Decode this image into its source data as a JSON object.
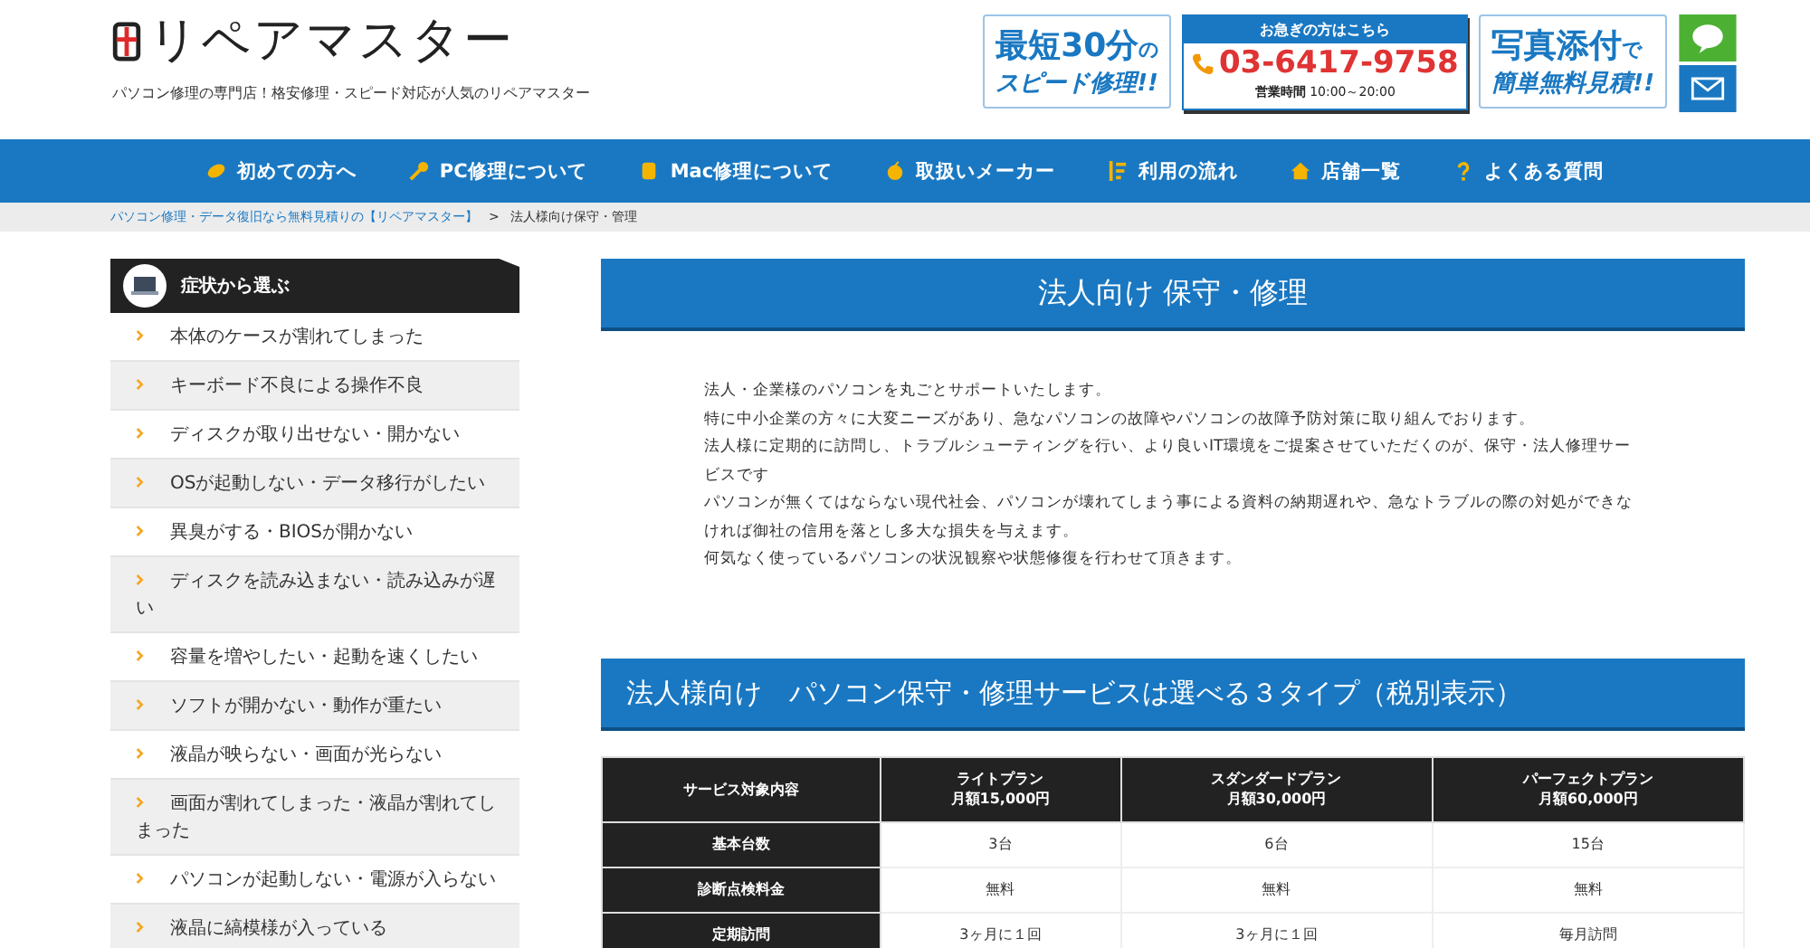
{
  "header": {
    "logo": "リペアマスター",
    "tagline": "パソコン修理の専門店！格安修理・スピード対応が人気のリペアマスター",
    "speed_banner": {
      "main": "最短30分",
      "suffix": "の",
      "sub": "スピード修理!!"
    },
    "phone_banner": {
      "label": "お急ぎの方はこちら",
      "number": "03-6417-9758",
      "hours_label": "営業時間",
      "hours": "10:00～20:00"
    },
    "photo_banner": {
      "main": "写真添付",
      "suffix": "で",
      "sub": "簡単無料見積!!"
    }
  },
  "nav": [
    {
      "label": "初めての方へ"
    },
    {
      "label": "PC修理について"
    },
    {
      "label": "Mac修理について"
    },
    {
      "label": "取扱いメーカー"
    },
    {
      "label": "利用の流れ"
    },
    {
      "label": "店舗一覧"
    },
    {
      "label": "よくある質問"
    }
  ],
  "breadcrumb": {
    "items": [
      "パソコン修理・データ復旧なら無料見積りの【リペアマスター】",
      "法人様向け保守・管理"
    ],
    "separator": ">"
  },
  "sidebar": {
    "title": "症状から選ぶ",
    "items": [
      "本体のケースが割れてしまった",
      "キーボード不良による操作不良",
      "ディスクが取り出せない・開かない",
      "OSが起動しない・データ移行がしたい",
      "異臭がする・BIOSが開かない",
      "ディスクを読み込まない・読み込みが遅い",
      "容量を増やしたい・起動を速くしたい",
      "ソフトが開かない・動作が重たい",
      "液晶が映らない・画面が光らない",
      "画面が割れてしまった・液晶が割れてしまった",
      "パソコンが起動しない・電源が入らない",
      "液晶に縞模様が入っている"
    ]
  },
  "main": {
    "heading": "法人向け 保守・修理",
    "paragraphs": [
      "法人・企業様のパソコンを丸ごとサポートいたします。",
      "特に中小企業の方々に大変ニーズがあり、急なパソコンの故障やパソコンの故障予防対策に取り組んでおります。",
      "法人様に定期的に訪問し、トラブルシューティングを行い、より良いIT環境をご提案させていただくのが、保守・法人修理サービスです",
      "パソコンが無くてはならない現代社会、パソコンが壊れてしまう事による資料の納期遅れや、急なトラブルの際の対処ができなければ御社の信用を落とし多大な損失を与えます。",
      "何気なく使っているパソコンの状況観察や状態修復を行わせて頂きます。"
    ],
    "heading2": "法人様向け　パソコン保守・修理サービスは選べる３タイプ（税別表示）",
    "table": {
      "columns": [
        {
          "name": "サービス対象内容"
        },
        {
          "name": "ライトプラン",
          "price": "月額15,000円"
        },
        {
          "name": "スダンダードプラン",
          "price": "月額30,000円"
        },
        {
          "name": "パーフェクトプラン",
          "price": "月額60,000円"
        }
      ],
      "rows": [
        {
          "cells": [
            "基本台数",
            "3台",
            "6台",
            "15台"
          ]
        },
        {
          "cells": [
            "診断点検料金",
            "無料",
            "無料",
            "無料"
          ]
        },
        {
          "cells": [
            "定期訪問",
            "3ヶ月に１回",
            "3ヶ月に１回",
            "毎月訪問"
          ]
        }
      ]
    }
  }
}
